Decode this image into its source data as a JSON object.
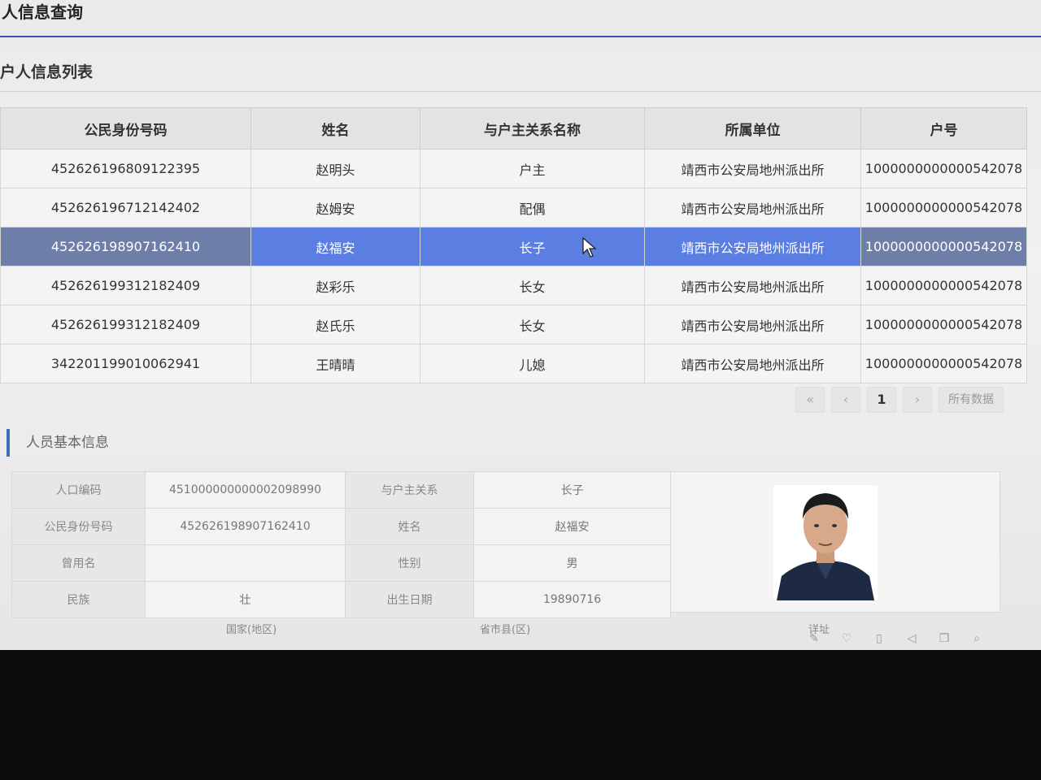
{
  "page": {
    "title": "人信息查询",
    "list_title": "户人信息列表"
  },
  "table": {
    "columns": [
      "公民身份号码",
      "姓名",
      "与户主关系名称",
      "所属单位",
      "户号"
    ],
    "rows": [
      [
        "452626196809122395",
        "赵明头",
        "户主",
        "靖西市公安局地州派出所",
        "1000000000000542078"
      ],
      [
        "452626196712142402",
        "赵姆安",
        "配偶",
        "靖西市公安局地州派出所",
        "1000000000000542078"
      ],
      [
        "452626198907162410",
        "赵福安",
        "长子",
        "靖西市公安局地州派出所",
        "1000000000000542078"
      ],
      [
        "452626199312182409",
        "赵彩乐",
        "长女",
        "靖西市公安局地州派出所",
        "1000000000000542078"
      ],
      [
        "452626199312182409",
        "赵氏乐",
        "长女",
        "靖西市公安局地州派出所",
        "1000000000000542078"
      ],
      [
        "342201199010062941",
        "王晴晴",
        "儿媳",
        "靖西市公安局地州派出所",
        "1000000000000542078"
      ]
    ],
    "selected_index": 2
  },
  "pager": {
    "first": "«",
    "prev": "‹",
    "current": "1",
    "next": "›",
    "all": "所有数据"
  },
  "basic_info": {
    "section_title": "人员基本信息",
    "pop_code_label": "人口编码",
    "pop_code_value": "451000000000002098990",
    "relation_label": "与户主关系",
    "relation_value": "长子",
    "id_label": "公民身份号码",
    "id_value": "452626198907162410",
    "name_label": "姓名",
    "name_value": "赵福安",
    "alias_label": "曾用名",
    "alias_value": "",
    "gender_label": "性别",
    "gender_value": "男",
    "ethnic_label": "民族",
    "ethnic_value": "壮",
    "birth_label": "出生日期",
    "birth_value": "19890716",
    "country_label": "国家(地区)",
    "province_label": "省市县(区)",
    "address_label": "详址"
  },
  "icons": [
    "pin-icon",
    "heart-icon",
    "trash-icon",
    "speaker-icon",
    "copy-icon",
    "search-icon"
  ]
}
